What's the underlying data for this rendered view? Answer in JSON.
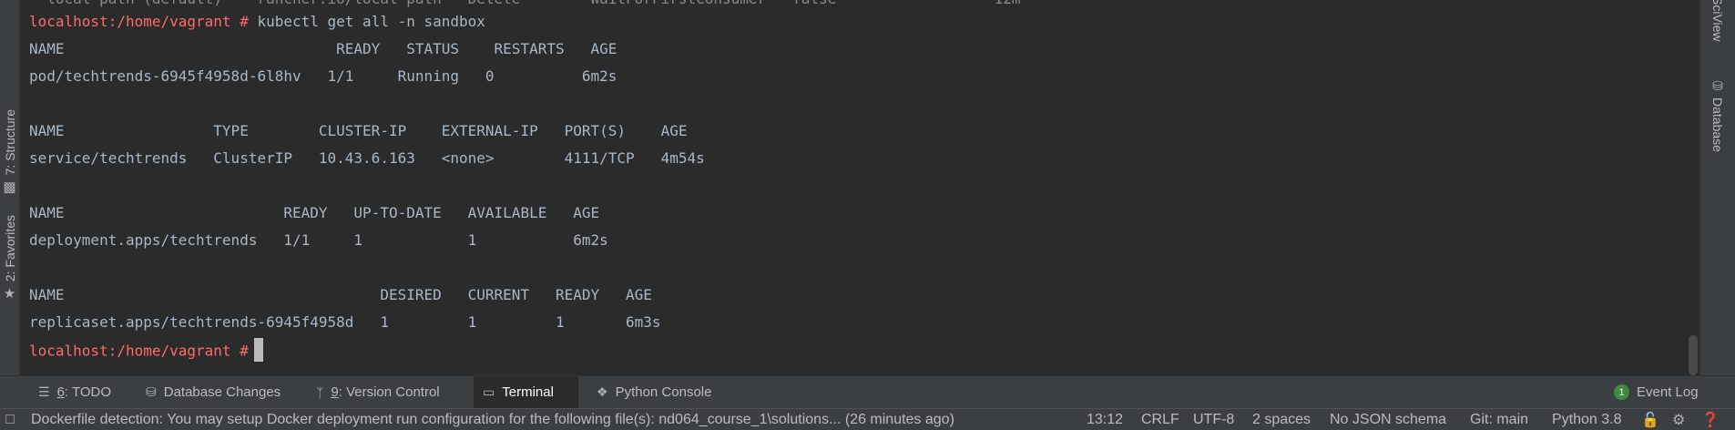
{
  "left_stripe": {
    "structure": "7: Structure",
    "favorites": "2: Favorites"
  },
  "right_stripe": {
    "sciview": "SciView",
    "database": "Database"
  },
  "terminal": {
    "top_partial": "  local path (default)    rancher.io/local-path   Delete        WaitForFirstConsumer   false                  12m",
    "prompt": "localhost:/home/vagrant #",
    "command": " kubectl get all -n sandbox",
    "lines": [
      "NAME                               READY   STATUS    RESTARTS   AGE",
      "pod/techtrends-6945f4958d-6l8hv   1/1     Running   0          6m2s",
      "",
      "NAME                 TYPE        CLUSTER-IP    EXTERNAL-IP   PORT(S)    AGE",
      "service/techtrends   ClusterIP   10.43.6.163   <none>        4111/TCP   4m54s",
      "",
      "NAME                         READY   UP-TO-DATE   AVAILABLE   AGE",
      "deployment.apps/techtrends   1/1     1            1           6m2s",
      "",
      "NAME                                    DESIRED   CURRENT   READY   AGE",
      "replicaset.apps/techtrends-6945f4958d   1         1         1       6m3s"
    ],
    "final_prompt": "localhost:/home/vagrant #"
  },
  "tool_windows": {
    "todo_num": "6",
    "todo_label": ": TODO",
    "db_changes": "Database Changes",
    "vc_num": "9",
    "vc_label": ": Version Control",
    "terminal": "Terminal",
    "python_console": "Python Console",
    "event_log_count": "1",
    "event_log": "Event Log"
  },
  "status_bar": {
    "message": "Dockerfile detection: You may setup Docker deployment run configuration for the following file(s): nd064_course_1\\solutions... (26 minutes ago)",
    "position": "13:12",
    "line_sep": "CRLF",
    "encoding": "UTF-8",
    "indent": "2 spaces",
    "schema": "No JSON schema",
    "git": "Git: main",
    "interpreter": "Python 3.8"
  }
}
